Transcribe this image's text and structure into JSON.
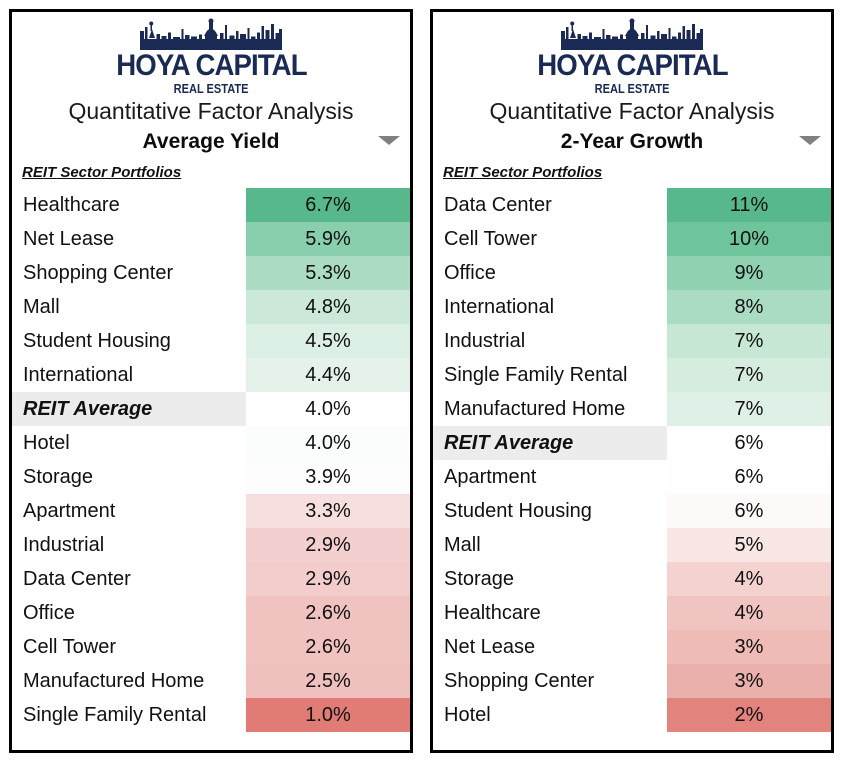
{
  "brand": {
    "name": "HOYA CAPITAL",
    "tagline": "REAL ESTATE",
    "skyline_icon": "city-skyline-icon",
    "navy": "#1b2a55"
  },
  "panels": [
    {
      "id": "average-yield",
      "title": "Quantitative Factor Analysis",
      "subtitle": "Average Yield",
      "filter_icon": "chevron-down-icon",
      "column_header": "REIT Sector Portfolios",
      "rows": [
        {
          "label": "Healthcare",
          "value": "6.7%",
          "color": "#57b98b",
          "average": false
        },
        {
          "label": "Net Lease",
          "value": "5.9%",
          "color": "#89cfae",
          "average": false
        },
        {
          "label": "Shopping Center",
          "value": "5.3%",
          "color": "#abdcc3",
          "average": false
        },
        {
          "label": "Mall",
          "value": "4.8%",
          "color": "#cbe8d8",
          "average": false
        },
        {
          "label": "Student Housing",
          "value": "4.5%",
          "color": "#dcefe4",
          "average": false
        },
        {
          "label": "International",
          "value": "4.4%",
          "color": "#e4f2ea",
          "average": false
        },
        {
          "label": "REIT Average",
          "value": "4.0%",
          "color": "#ffffff",
          "average": true
        },
        {
          "label": "Hotel",
          "value": "4.0%",
          "color": "#fbfdfc",
          "average": false
        },
        {
          "label": "Storage",
          "value": "3.9%",
          "color": "#fefdfd",
          "average": false
        },
        {
          "label": "Apartment",
          "value": "3.3%",
          "color": "#f7dfdf",
          "average": false
        },
        {
          "label": "Industrial",
          "value": "2.9%",
          "color": "#f4cfcf",
          "average": false
        },
        {
          "label": "Data Center",
          "value": "2.9%",
          "color": "#f3cccc",
          "average": false
        },
        {
          "label": "Office",
          "value": "2.6%",
          "color": "#f0c2c0",
          "average": false
        },
        {
          "label": "Cell Tower",
          "value": "2.6%",
          "color": "#f0c2c0",
          "average": false
        },
        {
          "label": "Manufactured Home",
          "value": "2.5%",
          "color": "#efc0be",
          "average": false
        },
        {
          "label": "Single Family Rental",
          "value": "1.0%",
          "color": "#e17b76",
          "average": false
        }
      ]
    },
    {
      "id": "two-year-growth",
      "title": "Quantitative Factor Analysis",
      "subtitle": "2-Year Growth",
      "filter_icon": "chevron-down-icon",
      "column_header": "REIT Sector Portfolios",
      "rows": [
        {
          "label": "Data Center",
          "value": "11%",
          "color": "#57b98b",
          "average": false
        },
        {
          "label": "Cell Tower",
          "value": "10%",
          "color": "#6ec49b",
          "average": false
        },
        {
          "label": "Office",
          "value": "9%",
          "color": "#8fd1b1",
          "average": false
        },
        {
          "label": "International",
          "value": "8%",
          "color": "#a9dcc2",
          "average": false
        },
        {
          "label": "Industrial",
          "value": "7%",
          "color": "#c5e7d4",
          "average": false
        },
        {
          "label": "Single Family Rental",
          "value": "7%",
          "color": "#d5ecdf",
          "average": false
        },
        {
          "label": "Manufactured Home",
          "value": "7%",
          "color": "#dff0e6",
          "average": false
        },
        {
          "label": "REIT Average",
          "value": "6%",
          "color": "#ffffff",
          "average": true
        },
        {
          "label": "Apartment",
          "value": "6%",
          "color": "#fefefe",
          "average": false
        },
        {
          "label": "Student Housing",
          "value": "6%",
          "color": "#fcf9f8",
          "average": false
        },
        {
          "label": "Mall",
          "value": "5%",
          "color": "#f9e7e5",
          "average": false
        },
        {
          "label": "Storage",
          "value": "4%",
          "color": "#f4d2d0",
          "average": false
        },
        {
          "label": "Healthcare",
          "value": "4%",
          "color": "#f0c4c1",
          "average": false
        },
        {
          "label": "Net Lease",
          "value": "3%",
          "color": "#eebbb7",
          "average": false
        },
        {
          "label": "Shopping Center",
          "value": "3%",
          "color": "#eab0ac",
          "average": false
        },
        {
          "label": "Hotel",
          "value": "2%",
          "color": "#e3837d",
          "average": false
        }
      ]
    }
  ]
}
